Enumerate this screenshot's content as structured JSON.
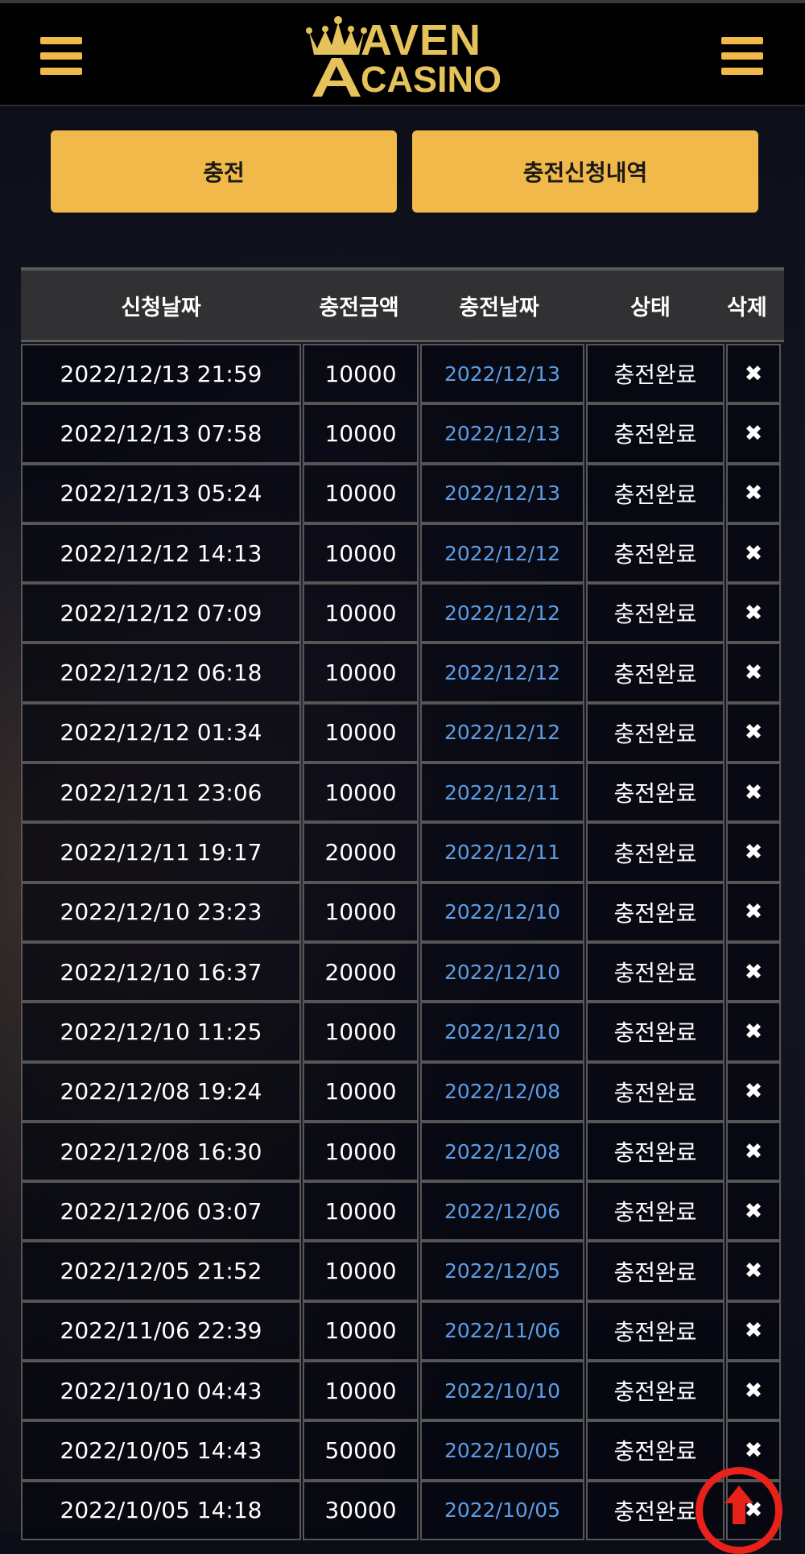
{
  "header": {
    "logo_line1": "AVEN",
    "logo_line2": "CASINO",
    "menu_left_icon": "hamburger-menu-icon",
    "menu_right_icon": "hamburger-menu-icon"
  },
  "actions": {
    "charge_label": "충전",
    "history_label": "충전신청내역"
  },
  "table": {
    "columns": [
      "신청날짜",
      "충전금액",
      "충전날짜",
      "상태",
      "삭제"
    ],
    "rows": [
      {
        "request_date": "2022/12/13 21:59",
        "amount": "10000",
        "charge_date": "2022/12/13",
        "status": "충전완료",
        "delete": "✖"
      },
      {
        "request_date": "2022/12/13 07:58",
        "amount": "10000",
        "charge_date": "2022/12/13",
        "status": "충전완료",
        "delete": "✖"
      },
      {
        "request_date": "2022/12/13 05:24",
        "amount": "10000",
        "charge_date": "2022/12/13",
        "status": "충전완료",
        "delete": "✖"
      },
      {
        "request_date": "2022/12/12 14:13",
        "amount": "10000",
        "charge_date": "2022/12/12",
        "status": "충전완료",
        "delete": "✖"
      },
      {
        "request_date": "2022/12/12 07:09",
        "amount": "10000",
        "charge_date": "2022/12/12",
        "status": "충전완료",
        "delete": "✖"
      },
      {
        "request_date": "2022/12/12 06:18",
        "amount": "10000",
        "charge_date": "2022/12/12",
        "status": "충전완료",
        "delete": "✖"
      },
      {
        "request_date": "2022/12/12 01:34",
        "amount": "10000",
        "charge_date": "2022/12/12",
        "status": "충전완료",
        "delete": "✖"
      },
      {
        "request_date": "2022/12/11 23:06",
        "amount": "10000",
        "charge_date": "2022/12/11",
        "status": "충전완료",
        "delete": "✖"
      },
      {
        "request_date": "2022/12/11 19:17",
        "amount": "20000",
        "charge_date": "2022/12/11",
        "status": "충전완료",
        "delete": "✖"
      },
      {
        "request_date": "2022/12/10 23:23",
        "amount": "10000",
        "charge_date": "2022/12/10",
        "status": "충전완료",
        "delete": "✖"
      },
      {
        "request_date": "2022/12/10 16:37",
        "amount": "20000",
        "charge_date": "2022/12/10",
        "status": "충전완료",
        "delete": "✖"
      },
      {
        "request_date": "2022/12/10 11:25",
        "amount": "10000",
        "charge_date": "2022/12/10",
        "status": "충전완료",
        "delete": "✖"
      },
      {
        "request_date": "2022/12/08 19:24",
        "amount": "10000",
        "charge_date": "2022/12/08",
        "status": "충전완료",
        "delete": "✖"
      },
      {
        "request_date": "2022/12/08 16:30",
        "amount": "10000",
        "charge_date": "2022/12/08",
        "status": "충전완료",
        "delete": "✖"
      },
      {
        "request_date": "2022/12/06 03:07",
        "amount": "10000",
        "charge_date": "2022/12/06",
        "status": "충전완료",
        "delete": "✖"
      },
      {
        "request_date": "2022/12/05 21:52",
        "amount": "10000",
        "charge_date": "2022/12/05",
        "status": "충전완료",
        "delete": "✖"
      },
      {
        "request_date": "2022/11/06 22:39",
        "amount": "10000",
        "charge_date": "2022/11/06",
        "status": "충전완료",
        "delete": "✖"
      },
      {
        "request_date": "2022/10/10 04:43",
        "amount": "10000",
        "charge_date": "2022/10/10",
        "status": "충전완료",
        "delete": "✖"
      },
      {
        "request_date": "2022/10/05 14:43",
        "amount": "50000",
        "charge_date": "2022/10/05",
        "status": "충전완료",
        "delete": "✖"
      },
      {
        "request_date": "2022/10/05 14:18",
        "amount": "30000",
        "charge_date": "2022/10/05",
        "status": "충전완료",
        "delete": "✖"
      }
    ]
  },
  "scroll_top_icon": "arrow-up-circle-icon",
  "colors": {
    "accent": "#f1b94a",
    "link_date": "#5b9ee8",
    "scroll_top": "#e8211a"
  }
}
